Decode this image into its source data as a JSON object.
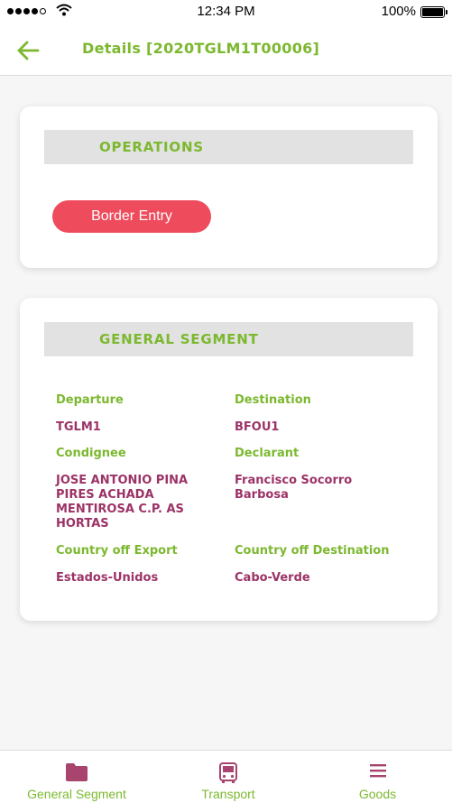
{
  "status_bar": {
    "time": "12:34 PM",
    "battery": "100%"
  },
  "header": {
    "title": "Details [2020TGLM1T00006]"
  },
  "operations": {
    "title": "OPERATIONS",
    "button": "Border Entry"
  },
  "general_segment": {
    "title": "GENERAL SEGMENT",
    "departure_label": "Departure",
    "departure_value": "TGLM1",
    "destination_label": "Destination",
    "destination_value": "BFOU1",
    "consignee_label": "Condignee",
    "consignee_value_1": "JOSE ANTONIO PINA",
    "consignee_value_2": "PIRES ACHADA",
    "consignee_value_3": "MENTIROSA C.P. AS",
    "consignee_value_4": "HORTAS",
    "declarant_label": "Declarant",
    "declarant_value_1": "Francisco Socorro",
    "declarant_value_2": "Barbosa",
    "export_label": "Country off Export",
    "export_value": "Estados-Unidos",
    "dest_country_label": "Country off Destination",
    "dest_country_value": "Cabo-Verde"
  },
  "tabs": [
    {
      "label": "General Segment",
      "icon": "folder-icon"
    },
    {
      "label": "Transport",
      "icon": "bus-icon"
    },
    {
      "label": "Goods",
      "icon": "list-icon"
    }
  ],
  "colors": {
    "accent_green": "#7cb82f",
    "value_purple": "#9c3366",
    "button_red": "#ee4b5c",
    "icon_purple": "#a8446e"
  }
}
